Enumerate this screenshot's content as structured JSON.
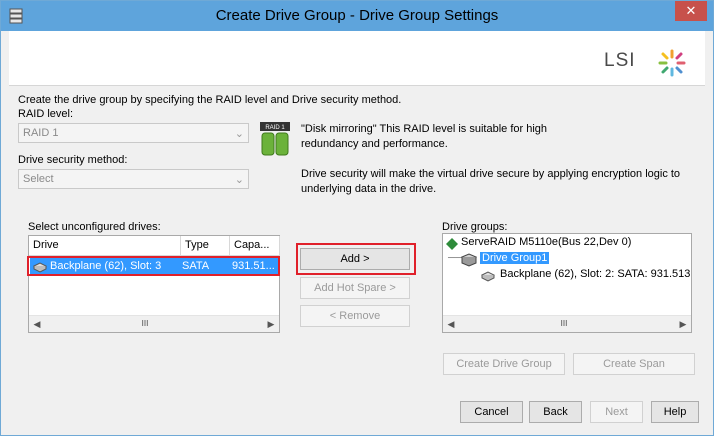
{
  "window": {
    "title": "Create Drive Group - Drive Group Settings",
    "close_label": "✕"
  },
  "logo": {
    "text": "LSI"
  },
  "intro_text": "Create the drive group by specifying the RAID level and Drive security method.",
  "raid": {
    "label": "RAID level:",
    "value": "RAID 1",
    "icon_badge": "RAID 1",
    "description": "\"Disk mirroring\" This RAID level is suitable for high redundancy and performance."
  },
  "security": {
    "label": "Drive security method:",
    "value": "Select",
    "description": "Drive security will make the virtual drive secure by applying encryption logic to underlying data in the drive."
  },
  "unconfigured": {
    "label": "Select unconfigured drives:",
    "columns": [
      "Drive",
      "Type",
      "Capa..."
    ],
    "rows": [
      {
        "drive": "Backplane (62), Slot: 3",
        "type": "SATA",
        "capacity": "931.51..."
      }
    ]
  },
  "actions": {
    "add": "Add >",
    "add_hot_spare": "Add Hot Spare >",
    "remove": "< Remove"
  },
  "drive_groups": {
    "label": "Drive groups:",
    "controller": "ServeRAID M5110e(Bus 22,Dev 0)",
    "group": "Drive Group1",
    "drive": "Backplane (62), Slot: 2: SATA: 931.513"
  },
  "group_buttons": {
    "create_drive_group": "Create Drive Group",
    "create_span": "Create Span"
  },
  "footer": {
    "cancel": "Cancel",
    "back": "Back",
    "next": "Next",
    "help": "Help"
  },
  "scroll_thumb_glyph": "III",
  "colors": {
    "titlebar": "#5ea4dc",
    "selection": "#3399ff",
    "highlight_box": "#e0202a",
    "close": "#c7514b"
  }
}
